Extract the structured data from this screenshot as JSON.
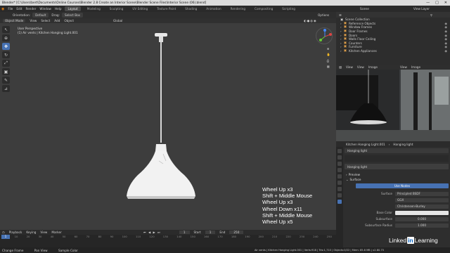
{
  "window": {
    "title": "Blender* [C:\\Users\\bert\\Documents\\Online Courses\\Blender 2.8 Create an Interior Scene\\Blender Scene Files\\Interior Scene (06).blend]",
    "controls": [
      "—",
      "□",
      "✕"
    ]
  },
  "menubar": {
    "items": [
      "File",
      "Edit",
      "Render",
      "Window",
      "Help"
    ],
    "workspaces": [
      {
        "label": "Layout",
        "active": true
      },
      {
        "label": "Modeling",
        "active": false
      },
      {
        "label": "Sculpting",
        "active": false
      },
      {
        "label": "UV Editing",
        "active": false
      },
      {
        "label": "Texture Paint",
        "active": false
      },
      {
        "label": "Shading",
        "active": false
      },
      {
        "label": "Animation",
        "active": false
      },
      {
        "label": "Rendering",
        "active": false
      },
      {
        "label": "Compositing",
        "active": false
      },
      {
        "label": "Scripting",
        "active": false
      }
    ],
    "scene": "Scene",
    "view_layer": "View Layer"
  },
  "viewport": {
    "header_left": [
      "Orientation:",
      "Default",
      "Drag:",
      "Select Box"
    ],
    "header_right": [
      "Options"
    ],
    "mode": "Object Mode",
    "menus": [
      "View",
      "Select",
      "Add",
      "Object"
    ],
    "transform": "Global",
    "info_line1": "User Perspective",
    "info_line2": "(1) Air vents | Kitchen Hanging Light.001",
    "keystrokes": [
      "Wheel Up x3",
      "Shift + Middle Mouse",
      "Wheel Up x3",
      "Wheel Down x11",
      "Shift + Middle Mouse",
      "Wheel Up x5"
    ]
  },
  "toolbar": {
    "tools": [
      {
        "icon": "select-cursor-icon",
        "glyph": "↖",
        "active": false
      },
      {
        "icon": "cursor-icon",
        "glyph": "⊕",
        "active": false
      },
      {
        "icon": "move-icon",
        "glyph": "✥",
        "active": true
      },
      {
        "icon": "rotate-icon",
        "glyph": "↻",
        "active": false
      },
      {
        "icon": "scale-icon",
        "glyph": "⤢",
        "active": false
      },
      {
        "icon": "transform-icon",
        "glyph": "▣",
        "active": false
      },
      {
        "icon": "annotate-icon",
        "glyph": "✎",
        "active": false
      },
      {
        "icon": "measure-icon",
        "glyph": "⊿",
        "active": false
      }
    ]
  },
  "timeline": {
    "menus": [
      "Playback",
      "Keying",
      "View",
      "Marker"
    ],
    "current_frame": "1",
    "start_label": "Start",
    "start": "1",
    "end_label": "End",
    "end": "250",
    "ruler": [
      "0",
      "10",
      "20",
      "30",
      "40",
      "50",
      "60",
      "70",
      "80",
      "90",
      "100",
      "110",
      "120",
      "130",
      "140",
      "150",
      "160",
      "170",
      "180",
      "190",
      "200",
      "210",
      "220",
      "230",
      "240",
      "250"
    ],
    "playhead": "1"
  },
  "statusbar": {
    "hints": [
      "Change Frame",
      "Pan View",
      "Sample Color"
    ],
    "stats": "Air vents | Kitchen Hanging Light.001 | Verts:918 | Tris:1,710 | Objects:0/22 | Mem: 85.8 MB | v2.80.75"
  },
  "outliner": {
    "title": "Scene Collection",
    "rows": [
      {
        "name": "Reference Objects"
      },
      {
        "name": "Window Frames"
      },
      {
        "name": "Door Frames"
      },
      {
        "name": "Doors"
      },
      {
        "name": "Walls Floor Ceiling"
      },
      {
        "name": "Counters"
      },
      {
        "name": "Furniture"
      },
      {
        "name": "Kitchen Appliances"
      }
    ]
  },
  "image_editor": {
    "menus": [
      "View",
      "View",
      "Image"
    ],
    "right_menus": [
      "View",
      "Image"
    ]
  },
  "properties": {
    "breadcrumb": [
      "Kitchen Hanging Light.001",
      "Hanging light"
    ],
    "material_slot": "Hanging light",
    "material_name": "Hanging light",
    "preview_label": "Preview",
    "surface_label": "Surface",
    "use_nodes": "Use Nodes",
    "fields": [
      {
        "label": "Surface",
        "value": "Principled BSDF"
      },
      {
        "label": "",
        "value": "GGX"
      },
      {
        "label": "",
        "value": "Christensen-Burley"
      },
      {
        "label": "Base Color",
        "value": ""
      },
      {
        "label": "Subsurface",
        "value": "0.000"
      },
      {
        "label": "Subsurface Radius",
        "value": "1.000"
      }
    ]
  },
  "watermark": {
    "text1": "Linked",
    "text2": "in",
    "text3": " Learning"
  }
}
